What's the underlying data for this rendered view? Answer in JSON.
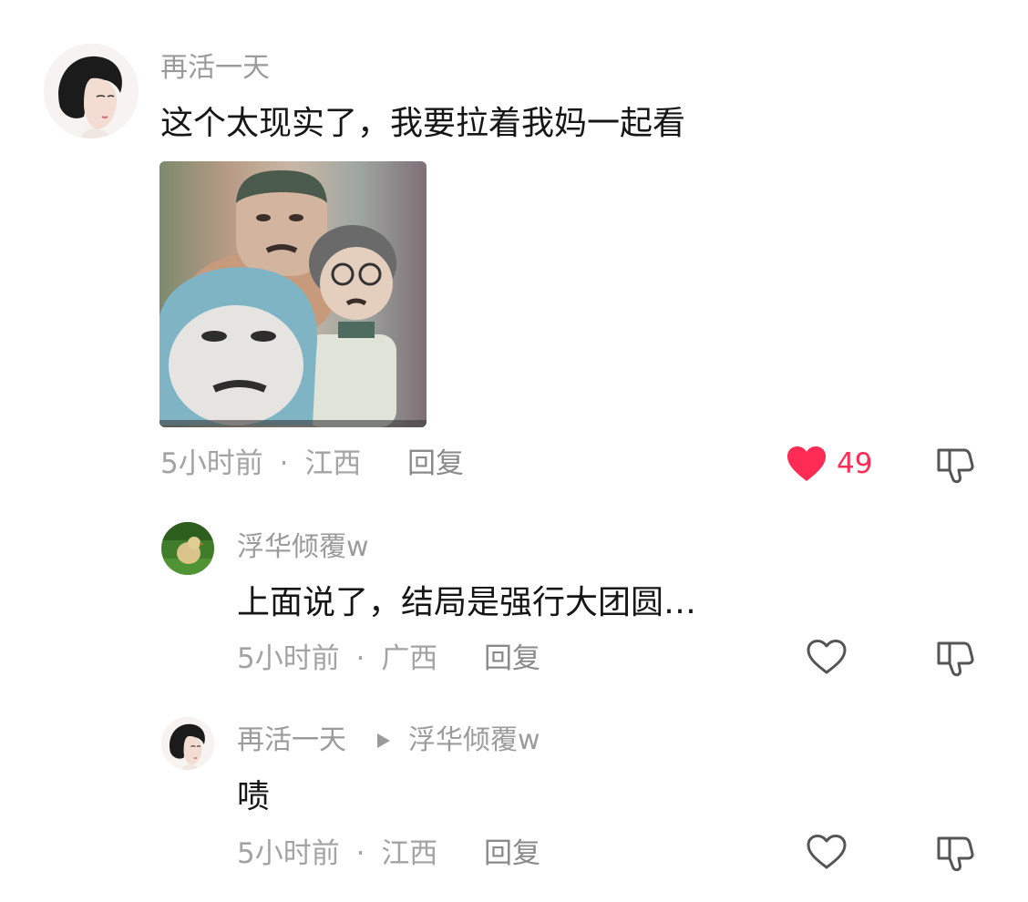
{
  "colors": {
    "like_active": "#fe2c55",
    "muted_text": "#9b9b9b",
    "icon_gray": "#8a8a8a"
  },
  "comments": [
    {
      "username": "再活一天",
      "text": "这个太现实了，我要拉着我妈一起看",
      "has_image": true,
      "image_icon": "meme-image",
      "time": "5小时前",
      "location": "江西",
      "separator": "·",
      "reply_label": "回复",
      "liked": true,
      "like_count": "49",
      "like_icon": "heart-filled-icon",
      "dislike_icon": "thumbs-down-icon"
    }
  ],
  "replies": [
    {
      "username": "浮华倾覆w",
      "text": "上面说了，结局是强行大团圆…",
      "time": "5小时前",
      "location": "广西",
      "separator": "·",
      "reply_label": "回复",
      "liked": false,
      "like_icon": "heart-outline-icon",
      "dislike_icon": "thumbs-down-icon"
    },
    {
      "username": "再活一天",
      "reply_to": "浮华倾覆w",
      "text": "啧",
      "time": "5小时前",
      "location": "江西",
      "separator": "·",
      "reply_label": "回复",
      "liked": false,
      "like_icon": "heart-outline-icon",
      "dislike_icon": "thumbs-down-icon"
    }
  ]
}
